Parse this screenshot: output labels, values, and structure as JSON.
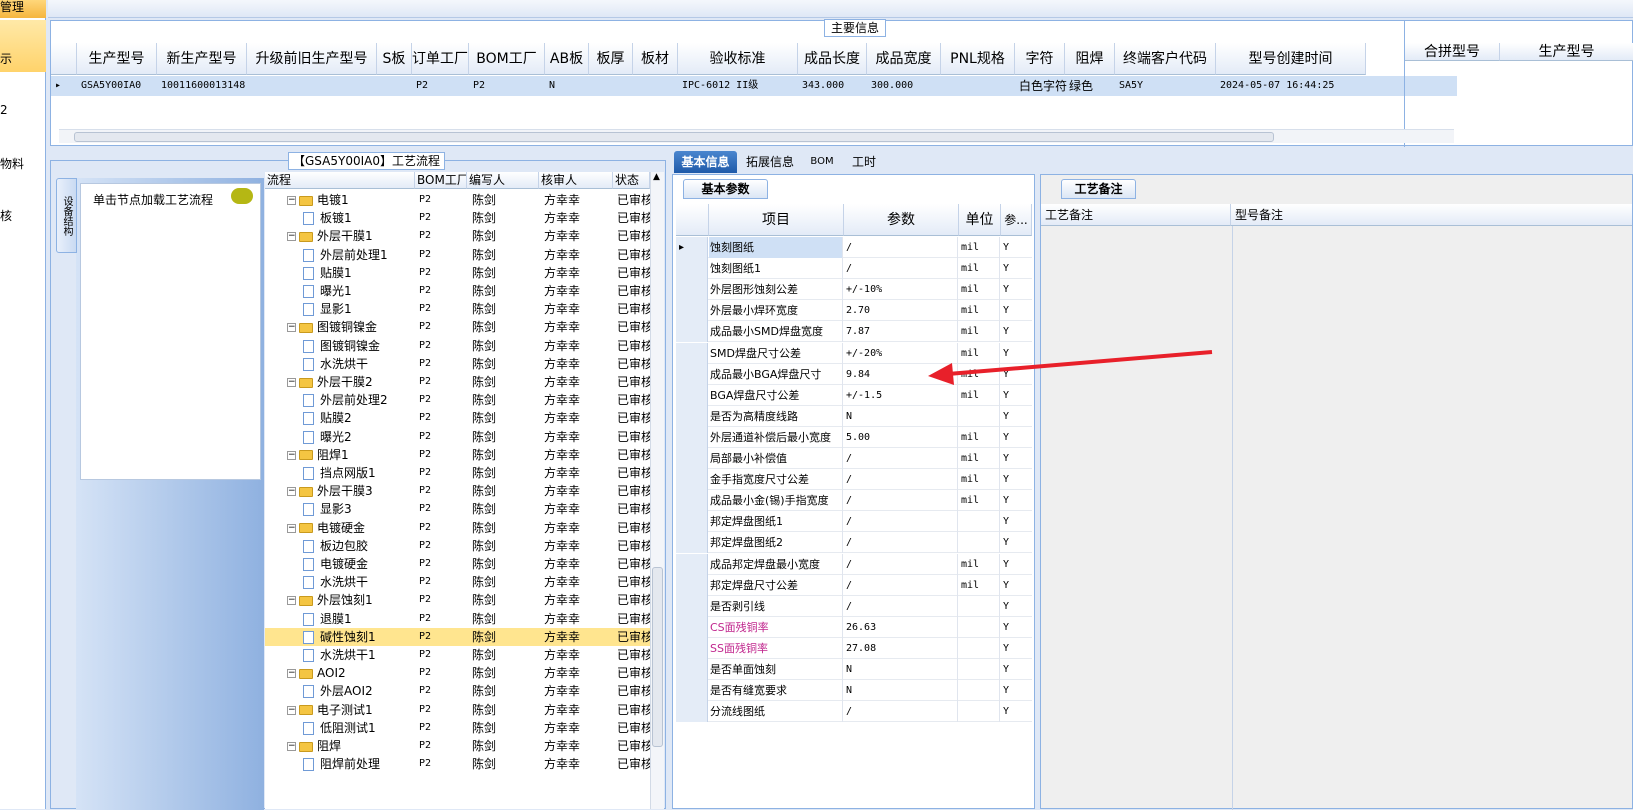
{
  "left_nav": {
    "header": "管理",
    "items": [
      "示",
      "2",
      "物料",
      "核"
    ]
  },
  "top": {
    "legend": "主要信息",
    "columns": [
      "生产型号",
      "新生产型号",
      "升级前旧生产型号",
      "S板",
      "订单工厂",
      "BOM工厂",
      "AB板",
      "板厚",
      "板材",
      "验收标准",
      "成品长度",
      "成品宽度",
      "PNL规格",
      "字符",
      "阻焊",
      "终端客户代码",
      "型号创建时间"
    ],
    "row": [
      "GSA5Y00IA0",
      "10011600013148",
      "",
      "",
      "P2",
      "P2",
      "N",
      "",
      "",
      "IPC-6012 II级",
      "343.000",
      "300.000",
      "",
      "白色字符",
      "绿色",
      "SA5Y",
      "2024-05-07 16:44:25"
    ],
    "right_columns": [
      "合拼型号",
      "生产型号"
    ]
  },
  "flow": {
    "legend": "【GSA5Y00IA0】工艺流程",
    "vtab": "设备结构",
    "hint": "单击节点加载工艺流程",
    "columns": [
      "流程",
      "BOM工厂",
      "编写人",
      "核审人",
      "状态"
    ],
    "rows": [
      {
        "name": "电镀1",
        "lvl": 0,
        "bom": "P2",
        "w": "陈剑",
        "r": "方幸幸",
        "s": "已审核"
      },
      {
        "name": "板镀1",
        "lvl": 1,
        "bom": "P2",
        "w": "陈剑",
        "r": "方幸幸",
        "s": "已审核"
      },
      {
        "name": "外层干膜1",
        "lvl": 0,
        "bom": "P2",
        "w": "陈剑",
        "r": "方幸幸",
        "s": "已审核"
      },
      {
        "name": "外层前处理1",
        "lvl": 1,
        "bom": "P2",
        "w": "陈剑",
        "r": "方幸幸",
        "s": "已审核"
      },
      {
        "name": "贴膜1",
        "lvl": 1,
        "bom": "P2",
        "w": "陈剑",
        "r": "方幸幸",
        "s": "已审核"
      },
      {
        "name": "曝光1",
        "lvl": 1,
        "bom": "P2",
        "w": "陈剑",
        "r": "方幸幸",
        "s": "已审核"
      },
      {
        "name": "显影1",
        "lvl": 1,
        "bom": "P2",
        "w": "陈剑",
        "r": "方幸幸",
        "s": "已审核"
      },
      {
        "name": "图镀铜镍金",
        "lvl": 0,
        "bom": "P2",
        "w": "陈剑",
        "r": "方幸幸",
        "s": "已审核"
      },
      {
        "name": "图镀铜镍金",
        "lvl": 1,
        "bom": "P2",
        "w": "陈剑",
        "r": "方幸幸",
        "s": "已审核"
      },
      {
        "name": "水洗烘干",
        "lvl": 1,
        "bom": "P2",
        "w": "陈剑",
        "r": "方幸幸",
        "s": "已审核"
      },
      {
        "name": "外层干膜2",
        "lvl": 0,
        "bom": "P2",
        "w": "陈剑",
        "r": "方幸幸",
        "s": "已审核"
      },
      {
        "name": "外层前处理2",
        "lvl": 1,
        "bom": "P2",
        "w": "陈剑",
        "r": "方幸幸",
        "s": "已审核"
      },
      {
        "name": "贴膜2",
        "lvl": 1,
        "bom": "P2",
        "w": "陈剑",
        "r": "方幸幸",
        "s": "已审核"
      },
      {
        "name": "曝光2",
        "lvl": 1,
        "bom": "P2",
        "w": "陈剑",
        "r": "方幸幸",
        "s": "已审核"
      },
      {
        "name": "阻焊1",
        "lvl": 0,
        "bom": "P2",
        "w": "陈剑",
        "r": "方幸幸",
        "s": "已审核"
      },
      {
        "name": "挡点网版1",
        "lvl": 1,
        "bom": "P2",
        "w": "陈剑",
        "r": "方幸幸",
        "s": "已审核"
      },
      {
        "name": "外层干膜3",
        "lvl": 0,
        "bom": "P2",
        "w": "陈剑",
        "r": "方幸幸",
        "s": "已审核"
      },
      {
        "name": "显影3",
        "lvl": 1,
        "bom": "P2",
        "w": "陈剑",
        "r": "方幸幸",
        "s": "已审核"
      },
      {
        "name": "电镀硬金",
        "lvl": 0,
        "bom": "P2",
        "w": "陈剑",
        "r": "方幸幸",
        "s": "已审核"
      },
      {
        "name": "板边包胶",
        "lvl": 1,
        "bom": "P2",
        "w": "陈剑",
        "r": "方幸幸",
        "s": "已审核"
      },
      {
        "name": "电镀硬金",
        "lvl": 1,
        "bom": "P2",
        "w": "陈剑",
        "r": "方幸幸",
        "s": "已审核"
      },
      {
        "name": "水洗烘干",
        "lvl": 1,
        "bom": "P2",
        "w": "陈剑",
        "r": "方幸幸",
        "s": "已审核"
      },
      {
        "name": "外层蚀刻1",
        "lvl": 0,
        "bom": "P2",
        "w": "陈剑",
        "r": "方幸幸",
        "s": "已审核"
      },
      {
        "name": "退膜1",
        "lvl": 1,
        "bom": "P2",
        "w": "陈剑",
        "r": "方幸幸",
        "s": "已审核"
      },
      {
        "name": "碱性蚀刻1",
        "lvl": 1,
        "bom": "P2",
        "w": "陈剑",
        "r": "方幸幸",
        "s": "已审核",
        "sel": true
      },
      {
        "name": "水洗烘干1",
        "lvl": 1,
        "bom": "P2",
        "w": "陈剑",
        "r": "方幸幸",
        "s": "已审核"
      },
      {
        "name": "AOI2",
        "lvl": 0,
        "bom": "P2",
        "w": "陈剑",
        "r": "方幸幸",
        "s": "已审核"
      },
      {
        "name": "外层AOI2",
        "lvl": 1,
        "bom": "P2",
        "w": "陈剑",
        "r": "方幸幸",
        "s": "已审核"
      },
      {
        "name": "电子测试1",
        "lvl": 0,
        "bom": "P2",
        "w": "陈剑",
        "r": "方幸幸",
        "s": "已审核"
      },
      {
        "name": "低阻测试1",
        "lvl": 1,
        "bom": "P2",
        "w": "陈剑",
        "r": "方幸幸",
        "s": "已审核"
      },
      {
        "name": "阻焊",
        "lvl": 0,
        "bom": "P2",
        "w": "陈剑",
        "r": "方幸幸",
        "s": "已审核"
      },
      {
        "name": "阻焊前处理",
        "lvl": 1,
        "bom": "P2",
        "w": "陈剑",
        "r": "方幸幸",
        "s": "已审核"
      }
    ]
  },
  "tabs": [
    "基本信息",
    "拓展信息",
    "BOM",
    "工时"
  ],
  "params": {
    "subtab": "基本参数",
    "columns": [
      "项目",
      "参数",
      "单位",
      "参..."
    ],
    "rows": [
      {
        "k": "蚀刻图纸",
        "v": "/",
        "u": "mil",
        "y": "Y",
        "sel": true
      },
      {
        "k": "蚀刻图纸1",
        "v": "/",
        "u": "mil",
        "y": "Y"
      },
      {
        "k": "外层图形蚀刻公差",
        "v": "+/-10%",
        "u": "mil",
        "y": "Y"
      },
      {
        "k": "外层最小焊环宽度",
        "v": "2.70",
        "u": "mil",
        "y": "Y"
      },
      {
        "k": "成品最小SMD焊盘宽度",
        "v": "7.87",
        "u": "mil",
        "y": "Y"
      },
      {
        "k": "SMD焊盘尺寸公差",
        "v": "+/-20%",
        "u": "mil",
        "y": "Y"
      },
      {
        "k": "成品最小BGA焊盘尺寸",
        "v": "9.84",
        "u": "mil",
        "y": "Y"
      },
      {
        "k": "BGA焊盘尺寸公差",
        "v": "+/-1.5",
        "u": "mil",
        "y": "Y"
      },
      {
        "k": "是否为高精度线路",
        "v": "N",
        "u": "",
        "y": "Y"
      },
      {
        "k": "外层通道补偿后最小宽度",
        "v": "5.00",
        "u": "mil",
        "y": "Y"
      },
      {
        "k": "局部最小补偿值",
        "v": "/",
        "u": "mil",
        "y": "Y"
      },
      {
        "k": "金手指宽度尺寸公差",
        "v": "/",
        "u": "mil",
        "y": "Y"
      },
      {
        "k": "成品最小金(锡)手指宽度",
        "v": "/",
        "u": "mil",
        "y": "Y"
      },
      {
        "k": "邦定焊盘图纸1",
        "v": "/",
        "u": "",
        "y": "Y"
      },
      {
        "k": "邦定焊盘图纸2",
        "v": "/",
        "u": "",
        "y": "Y"
      },
      {
        "k": "成品邦定焊盘最小宽度",
        "v": "/",
        "u": "mil",
        "y": "Y"
      },
      {
        "k": "邦定焊盘尺寸公差",
        "v": "/",
        "u": "mil",
        "y": "Y"
      },
      {
        "k": "是否剥引线",
        "v": "/",
        "u": "",
        "y": "Y"
      },
      {
        "k": "CS面残铜率",
        "v": "26.63",
        "u": "",
        "y": "Y",
        "pink": true
      },
      {
        "k": "SS面残铜率",
        "v": "27.08",
        "u": "",
        "y": "Y",
        "pink": true
      },
      {
        "k": "是否单面蚀刻",
        "v": "N",
        "u": "",
        "y": "Y"
      },
      {
        "k": "是否有缝宽要求",
        "v": "N",
        "u": "",
        "y": "Y"
      },
      {
        "k": "分流线图纸",
        "v": "/",
        "u": "",
        "y": "Y"
      }
    ]
  },
  "remarks": {
    "tab": "工艺备注",
    "col1": "工艺备注",
    "col2": "型号备注"
  },
  "colors": {
    "arrow": "#e8202a",
    "selected_row": "#ffe58f",
    "accent": "#1f5aa9"
  }
}
